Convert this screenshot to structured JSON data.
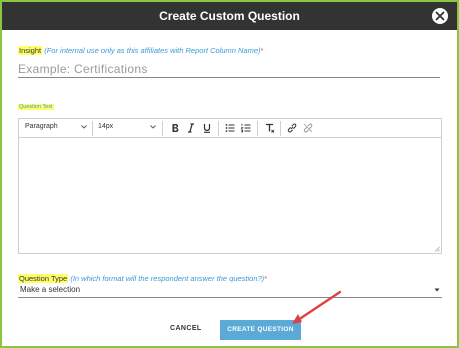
{
  "dialog": {
    "title": "Create Custom Question"
  },
  "insight": {
    "label": "Insight",
    "hint": "(For internal use only as this affiliates with Report Column Name)",
    "required": "*",
    "placeholder": "Example: Certifications"
  },
  "question_text": {
    "label": "Question Text",
    "toolbar": {
      "block_format": "Paragraph",
      "font_size": "14px",
      "buttons": [
        "bold-icon",
        "italic-icon",
        "underline-icon",
        "bullet-list-icon",
        "numbered-list-icon",
        "clear-format-icon",
        "link-icon",
        "unlink-icon"
      ]
    }
  },
  "question_type": {
    "label": "Question Type",
    "hint": "(In which format will the respondent answer the question?)",
    "required": "*",
    "selected": "Make a selection"
  },
  "footer": {
    "cancel_label": "CANCEL",
    "create_label": "CREATE QUESTION"
  },
  "colors": {
    "header_bg": "#333333",
    "highlight": "#ffff66",
    "hint": "#3a9ad9",
    "primary_button": "#5aa9d6",
    "frame_border": "#8cc63f",
    "annotation_arrow": "#e04040"
  }
}
